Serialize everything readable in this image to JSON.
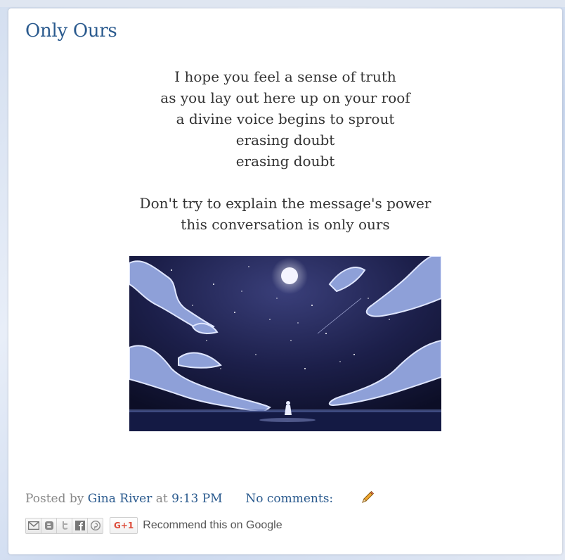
{
  "post": {
    "title": "Only Ours",
    "poem_lines_1": [
      "I hope you feel a sense of truth",
      "as you lay out here up on your roof",
      "a divine voice begins to sprout",
      "erasing doubt",
      "erasing doubt"
    ],
    "poem_lines_2": [
      "Don't try to explain the message's power",
      "this conversation is only ours"
    ]
  },
  "footer": {
    "posted_by": "Posted by",
    "author": "Gina River",
    "at": "at",
    "time": "9:13 PM",
    "comments": "No comments:"
  },
  "share": {
    "icons": [
      "email-icon",
      "blogger-icon",
      "twitter-icon",
      "facebook-icon",
      "pinterest-icon"
    ],
    "gplus_label": "G+1",
    "recommend_text": "Recommend this on Google"
  },
  "colors": {
    "title": "#2a5a8e",
    "link": "#2a5a8e",
    "gplus": "#dd4b39"
  }
}
